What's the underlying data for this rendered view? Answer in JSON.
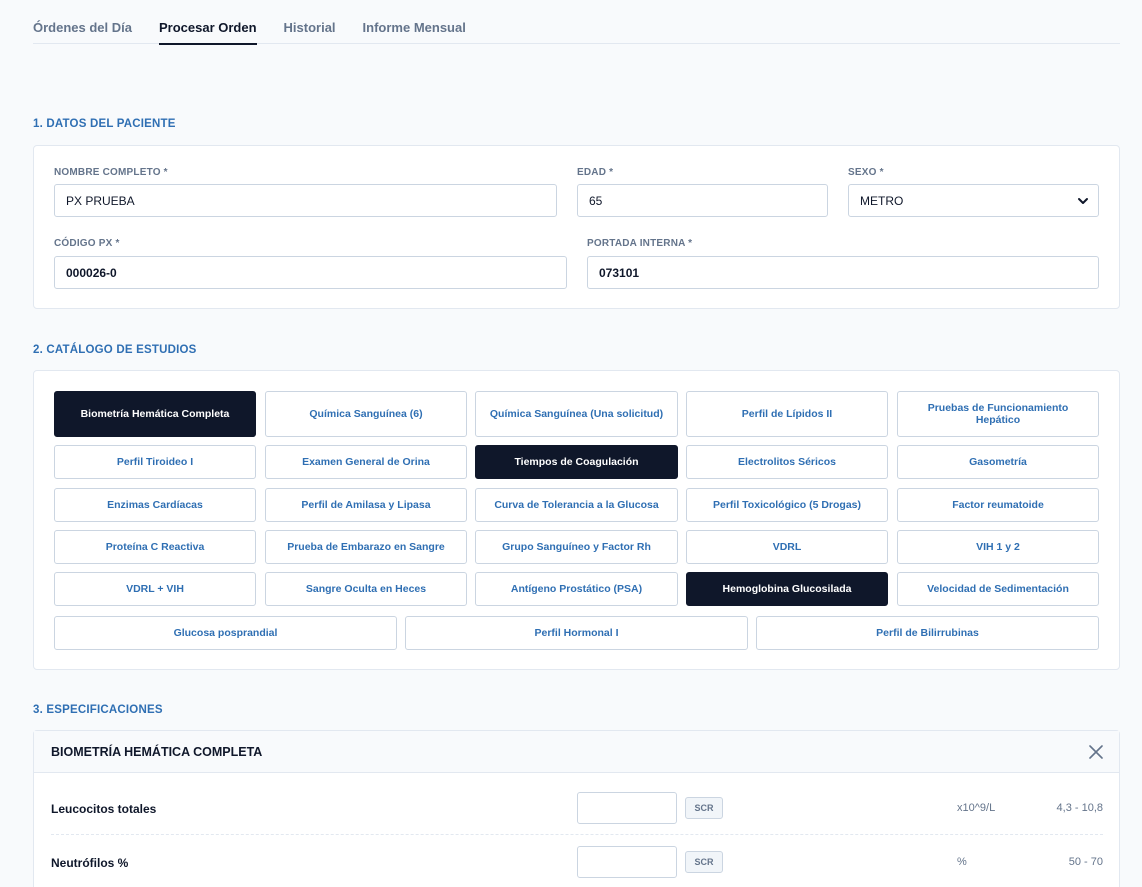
{
  "tabs": [
    {
      "label": "Órdenes del Día",
      "active": false
    },
    {
      "label": "Procesar Orden",
      "active": true
    },
    {
      "label": "Historial",
      "active": false
    },
    {
      "label": "Informe Mensual",
      "active": false
    }
  ],
  "patient": {
    "section_title": "1. DATOS DEL PACIENTE",
    "name_label": "NOMBRE COMPLETO *",
    "name_value": "PX PRUEBA",
    "age_label": "EDAD *",
    "age_value": "65",
    "sex_label": "SEXO *",
    "sex_value": "METRO",
    "code_label": "CÓDIGO PX *",
    "code_value": "000026-0",
    "cover_label": "PORTADA INTERNA *",
    "cover_value": "073101"
  },
  "catalog": {
    "section_title": "2. CATÁLOGO DE ESTUDIOS",
    "studies": [
      {
        "label": "Biometría Hemática Completa",
        "selected": true
      },
      {
        "label": "Química Sanguínea (6)",
        "selected": false
      },
      {
        "label": "Química Sanguínea (Una solicitud)",
        "selected": false
      },
      {
        "label": "Perfil de Lípidos II",
        "selected": false
      },
      {
        "label": "Pruebas de Funcionamiento Hepático",
        "selected": false
      },
      {
        "label": "Perfil Tiroideo I",
        "selected": false
      },
      {
        "label": "Examen General de Orina",
        "selected": false
      },
      {
        "label": "Tiempos de Coagulación",
        "selected": true
      },
      {
        "label": "Electrolitos Séricos",
        "selected": false
      },
      {
        "label": "Gasometría",
        "selected": false
      },
      {
        "label": "Enzimas Cardíacas",
        "selected": false
      },
      {
        "label": "Perfil de Amilasa y Lipasa",
        "selected": false
      },
      {
        "label": "Curva de Tolerancia a la Glucosa",
        "selected": false
      },
      {
        "label": "Perfil Toxicológico (5 Drogas)",
        "selected": false
      },
      {
        "label": "Factor reumatoide",
        "selected": false
      },
      {
        "label": "Proteína C Reactiva",
        "selected": false
      },
      {
        "label": "Prueba de Embarazo en Sangre",
        "selected": false
      },
      {
        "label": "Grupo Sanguíneo y Factor Rh",
        "selected": false
      },
      {
        "label": "VDRL",
        "selected": false
      },
      {
        "label": "VIH 1 y 2",
        "selected": false
      },
      {
        "label": "VDRL + VIH",
        "selected": false
      },
      {
        "label": "Sangre Oculta en Heces",
        "selected": false
      },
      {
        "label": "Antígeno Prostático (PSA)",
        "selected": false
      },
      {
        "label": "Hemoglobina Glucosilada",
        "selected": true
      },
      {
        "label": "Velocidad de Sedimentación",
        "selected": false
      },
      {
        "label": "Glucosa posprandial",
        "selected": false
      },
      {
        "label": "Perfil Hormonal I",
        "selected": false
      },
      {
        "label": "Perfil de Bilirrubinas",
        "selected": false
      }
    ]
  },
  "specs": {
    "section_title": "3. ESPECIFICACIONES",
    "panel_title": "BIOMETRÍA HEMÁTICA COMPLETA",
    "scr_label": "SCR",
    "rows": [
      {
        "name": "Leucocitos totales",
        "unit": "x10^9/L",
        "range": "4,3 - 10,8"
      },
      {
        "name": "Neutrófilos %",
        "unit": "%",
        "range": "50 - 70"
      }
    ]
  },
  "colors": {
    "accent": "#2f6fb3",
    "selected_bg": "#0f172a",
    "border": "#cbd5e1"
  }
}
